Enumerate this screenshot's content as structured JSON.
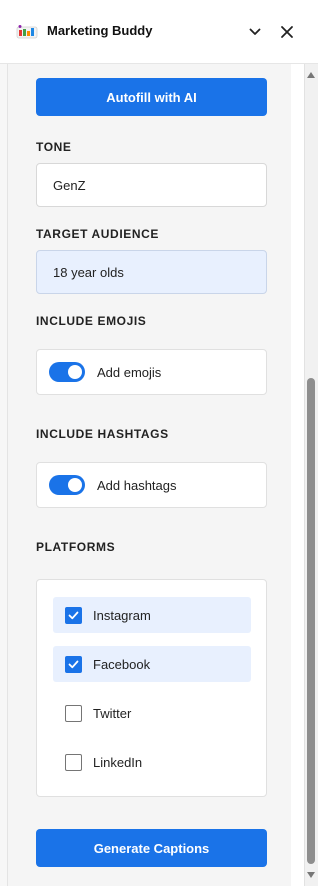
{
  "header": {
    "title": "Marketing Buddy",
    "logo_icon": "marketing-buddy-logo",
    "collapse_icon": "chevron-down-icon",
    "close_icon": "close-icon"
  },
  "actions": {
    "autofill_label": "Autofill with AI",
    "generate_label": "Generate Captions"
  },
  "tone": {
    "label": "TONE",
    "value": "GenZ"
  },
  "audience": {
    "label": "TARGET AUDIENCE",
    "value": "18 year olds"
  },
  "emojis": {
    "label": "INCLUDE EMOJIS",
    "toggle_label": "Add emojis",
    "enabled": true
  },
  "hashtags": {
    "label": "INCLUDE HASHTAGS",
    "toggle_label": "Add hashtags",
    "enabled": true
  },
  "platforms": {
    "label": "PLATFORMS",
    "items": [
      {
        "label": "Instagram",
        "checked": true
      },
      {
        "label": "Facebook",
        "checked": true
      },
      {
        "label": "Twitter",
        "checked": false
      },
      {
        "label": "LinkedIn",
        "checked": false
      }
    ]
  },
  "colors": {
    "accent": "#1a73e8",
    "selected_bg": "#e8f0fe",
    "panel_bg": "#f5f5f5"
  }
}
